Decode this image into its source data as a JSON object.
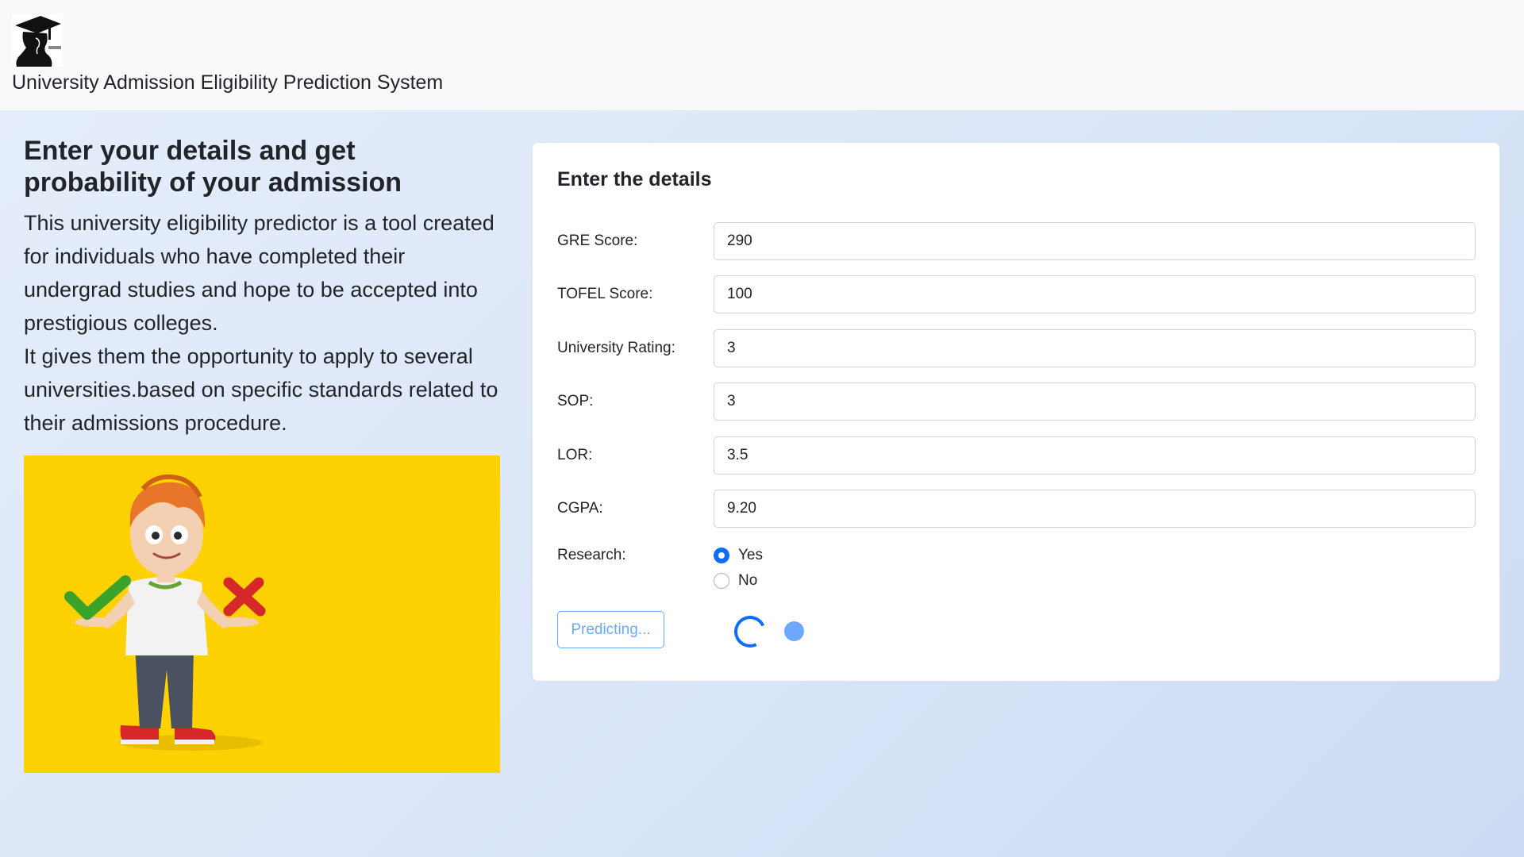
{
  "navbar": {
    "brand_title": "University Admission Eligibility Prediction System",
    "logo_icon": "graduate-silhouette-icon"
  },
  "intro": {
    "headline": "Enter your details and get probability of your admission",
    "paragraph_1": "This university eligibility predictor is a tool created for individuals who have completed their undergrad studies and hope to be accepted into prestigious colleges.",
    "paragraph_2": "It gives them the opportunity to apply to several universities.based on specific standards related to their admissions procedure.",
    "image": "cartoon-student-with-check-and-cross-illustration"
  },
  "form": {
    "title": "Enter the details",
    "fields": [
      {
        "label": "GRE Score:",
        "value": "290"
      },
      {
        "label": "TOFEL Score:",
        "value": "100"
      },
      {
        "label": "University Rating:",
        "value": "3"
      },
      {
        "label": "SOP:",
        "value": "3"
      },
      {
        "label": "LOR:",
        "value": "3.5"
      },
      {
        "label": "CGPA:",
        "value": "9.20"
      }
    ],
    "research": {
      "label": "Research:",
      "options": [
        "Yes",
        "No"
      ],
      "selected": "Yes"
    },
    "submit_label": "Predicting...",
    "loading_indicators": [
      "border-spinner-icon",
      "grow-spinner-icon"
    ]
  },
  "colors": {
    "primary": "#0d6efd",
    "primary_light": "#6ea8fe",
    "hero_background": "#fed103",
    "navbar_background": "#f8f9fa"
  }
}
